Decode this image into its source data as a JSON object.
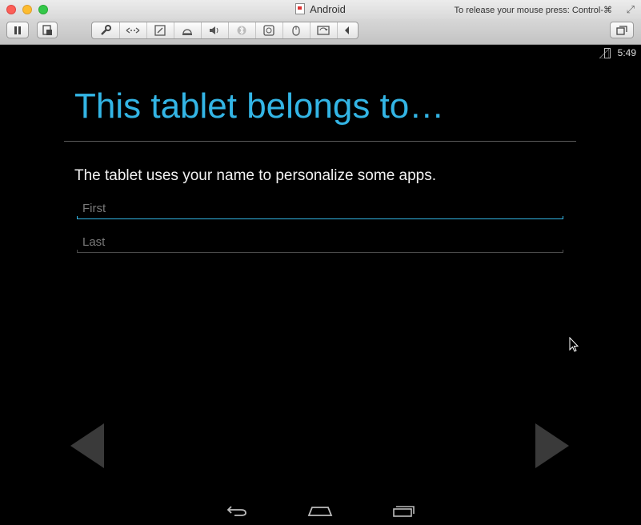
{
  "window": {
    "title": "Android",
    "release_hint": "To release your mouse press: Control-⌘"
  },
  "toolbar": {
    "left_buttons": [
      "pause-icon",
      "snapshot-icon"
    ],
    "device_icons": [
      "settings-wrench-icon",
      "network-icon",
      "hard-disk-icon",
      "camera-icon",
      "sound-icon",
      "bluetooth-icon",
      "cdrom-icon",
      "usb-mouse-icon",
      "shared-folder-icon",
      "collapse-arrow-icon"
    ],
    "right_buttons": [
      "window-mode-icon"
    ]
  },
  "status_bar": {
    "time": "5:49"
  },
  "setup": {
    "title": "This tablet belongs to…",
    "subtitle": "The tablet uses your name to personalize some apps.",
    "first_placeholder": "First",
    "last_placeholder": "Last",
    "first_value": "",
    "last_value": ""
  },
  "colors": {
    "accent": "#33b5e5",
    "background": "#000000",
    "nav_arrow": "#3a3a3a"
  },
  "navbar": [
    "back-icon",
    "home-icon",
    "recent-apps-icon"
  ]
}
